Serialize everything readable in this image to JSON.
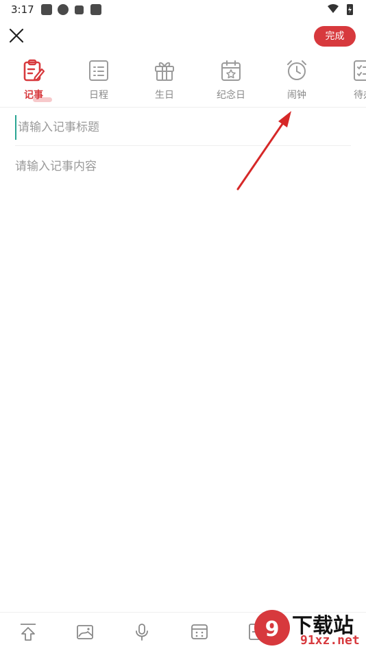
{
  "status_bar": {
    "time": "3:17"
  },
  "header": {
    "done_label": "完成"
  },
  "tabs": [
    {
      "label": "记事",
      "icon": "note-edit-icon",
      "active": true
    },
    {
      "label": "日程",
      "icon": "schedule-list-icon",
      "active": false
    },
    {
      "label": "生日",
      "icon": "gift-icon",
      "active": false
    },
    {
      "label": "纪念日",
      "icon": "calendar-star-icon",
      "active": false
    },
    {
      "label": "闹钟",
      "icon": "alarm-clock-icon",
      "active": false
    },
    {
      "label": "待办",
      "icon": "todo-checklist-icon",
      "active": false
    }
  ],
  "editor": {
    "title_placeholder": "请输入记事标题",
    "content_placeholder": "请输入记事内容"
  },
  "toolbar": {
    "items": [
      "share-icon",
      "image-icon",
      "microphone-icon",
      "calendar-grid-icon",
      "template-icon"
    ]
  },
  "watermark": {
    "main": "下载站",
    "sub": "91xz.net"
  },
  "colors": {
    "accent": "#d7393d",
    "cursor": "#29a593",
    "annotation_arrow": "#d62828"
  }
}
